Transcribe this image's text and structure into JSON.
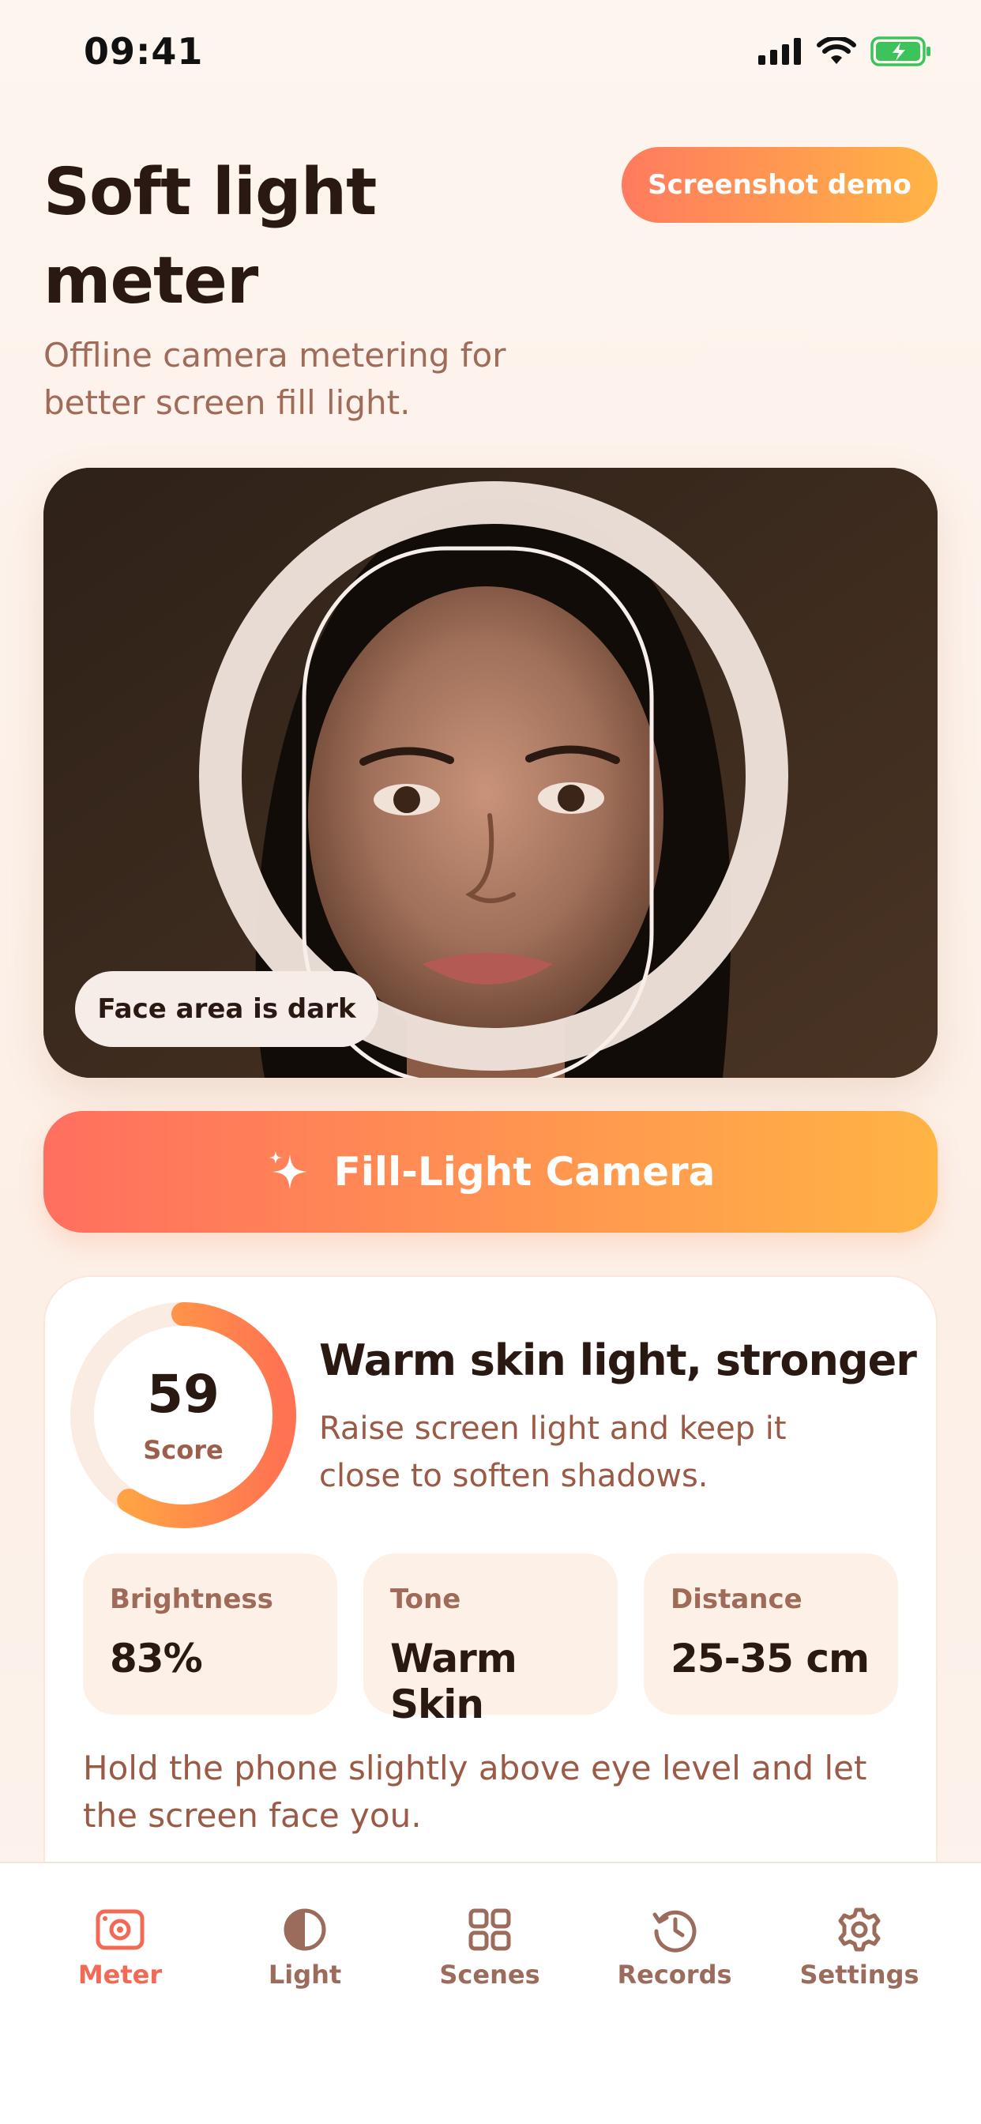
{
  "status_bar": {
    "time": "09:41"
  },
  "header": {
    "title": "Soft light meter",
    "subtitle": "Offline camera metering for better screen fill light.",
    "demo_button": "Screenshot demo"
  },
  "preview": {
    "badge": "Face area is dark"
  },
  "cta": {
    "label": "Fill-Light Camera",
    "icon": "sparkle-icon"
  },
  "result": {
    "score": "59",
    "score_label": "Score",
    "score_value": 59,
    "score_max": 100,
    "title": "Warm skin light, stronger",
    "description": "Raise screen light and keep it close to soften shadows.",
    "stats": [
      {
        "label": "Brightness",
        "value": "83%"
      },
      {
        "label": "Tone",
        "value": "Warm Skin"
      },
      {
        "label": "Distance",
        "value": "25-35 cm"
      }
    ],
    "tip": "Hold the phone slightly above eye level and let the screen face you."
  },
  "tabbar": {
    "items": [
      {
        "label": "Meter",
        "icon": "camera-meter-icon",
        "active": true
      },
      {
        "label": "Light",
        "icon": "half-circle-icon",
        "active": false
      },
      {
        "label": "Scenes",
        "icon": "grid-icon",
        "active": false
      },
      {
        "label": "Records",
        "icon": "history-icon",
        "active": false
      },
      {
        "label": "Settings",
        "icon": "gear-icon",
        "active": false
      }
    ]
  },
  "colors": {
    "accent_start": "#ff6f5f",
    "accent_end": "#ffb444",
    "background": "#fdf3ec",
    "text_primary": "#2a1812",
    "text_secondary": "#9b5a45",
    "tab_active": "#f26a55"
  }
}
